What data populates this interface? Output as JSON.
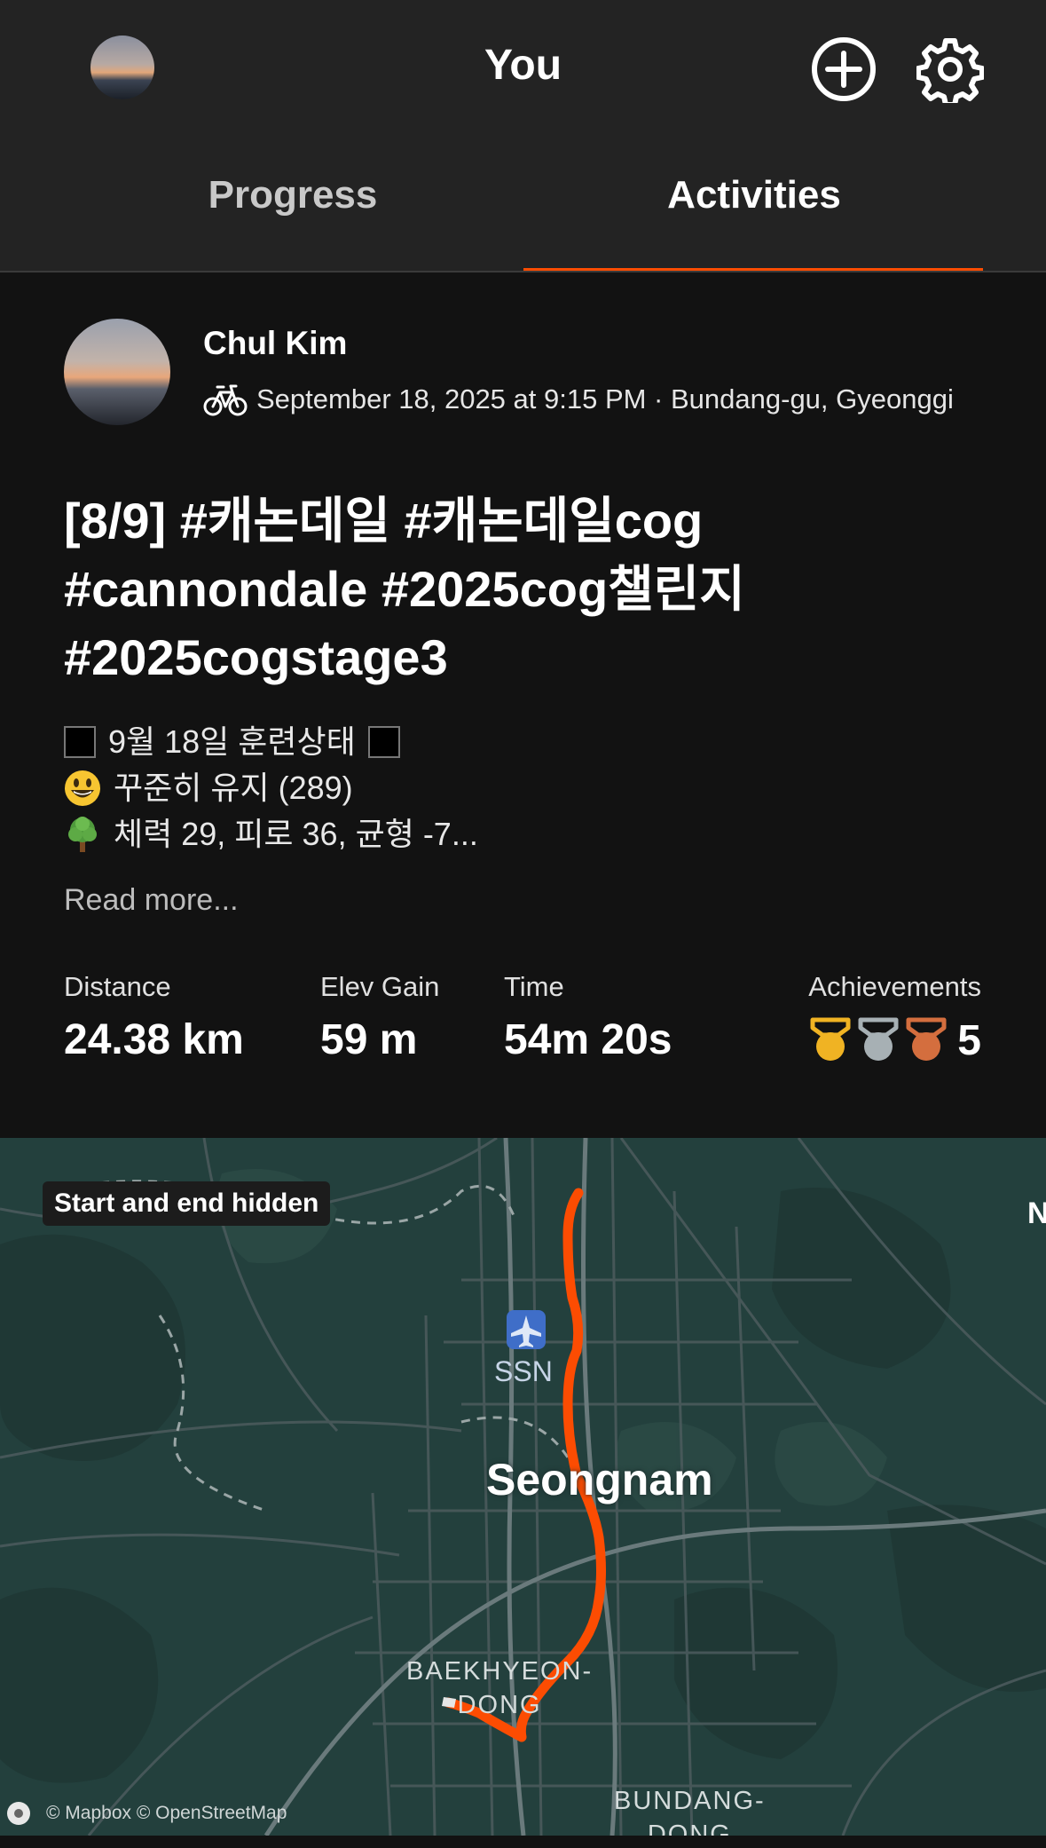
{
  "header": {
    "title": "You",
    "tabs": [
      {
        "label": "Progress",
        "active": false
      },
      {
        "label": "Activities",
        "active": true
      }
    ],
    "accent_color": "#fc4c02",
    "icons": {
      "add": "plus-circle-icon",
      "settings": "gear-icon"
    }
  },
  "activity": {
    "author": "Chul Kim",
    "sport_icon": "bike-icon",
    "meta": "September 18, 2025 at 9:15 PM · Bundang-gu, Gyeonggi",
    "title": "[8/9] #캐논데일 #캐논데일cog #cannondale #2025cog챌린지 #2025cogstage3",
    "description": {
      "line1": "9월 18일 훈련상태",
      "line2": "꾸준히 유지 (289)",
      "line3": "체력 29, 피로 36, 균형 -7..."
    },
    "read_more": "Read more...",
    "stats": {
      "distance": {
        "label": "Distance",
        "value": "24.38 km"
      },
      "elev_gain": {
        "label": "Elev Gain",
        "value": "59 m"
      },
      "time": {
        "label": "Time",
        "value": "54m 20s"
      },
      "achievements": {
        "label": "Achievements",
        "count": "5",
        "medals": [
          "gold",
          "silver",
          "bronze"
        ]
      }
    }
  },
  "map": {
    "badge": "Start and end hidden",
    "city": "Seongnam",
    "airport_code": "SSN",
    "district_1_line1": "BAEKHYEON-",
    "district_1_line2": "DONG",
    "district_2_line1": "BUNDANG-",
    "district_2_line2": "DONG",
    "edge_letter": "N",
    "attribution": "© Mapbox © OpenStreetMap",
    "route_color": "#fc4c02"
  }
}
